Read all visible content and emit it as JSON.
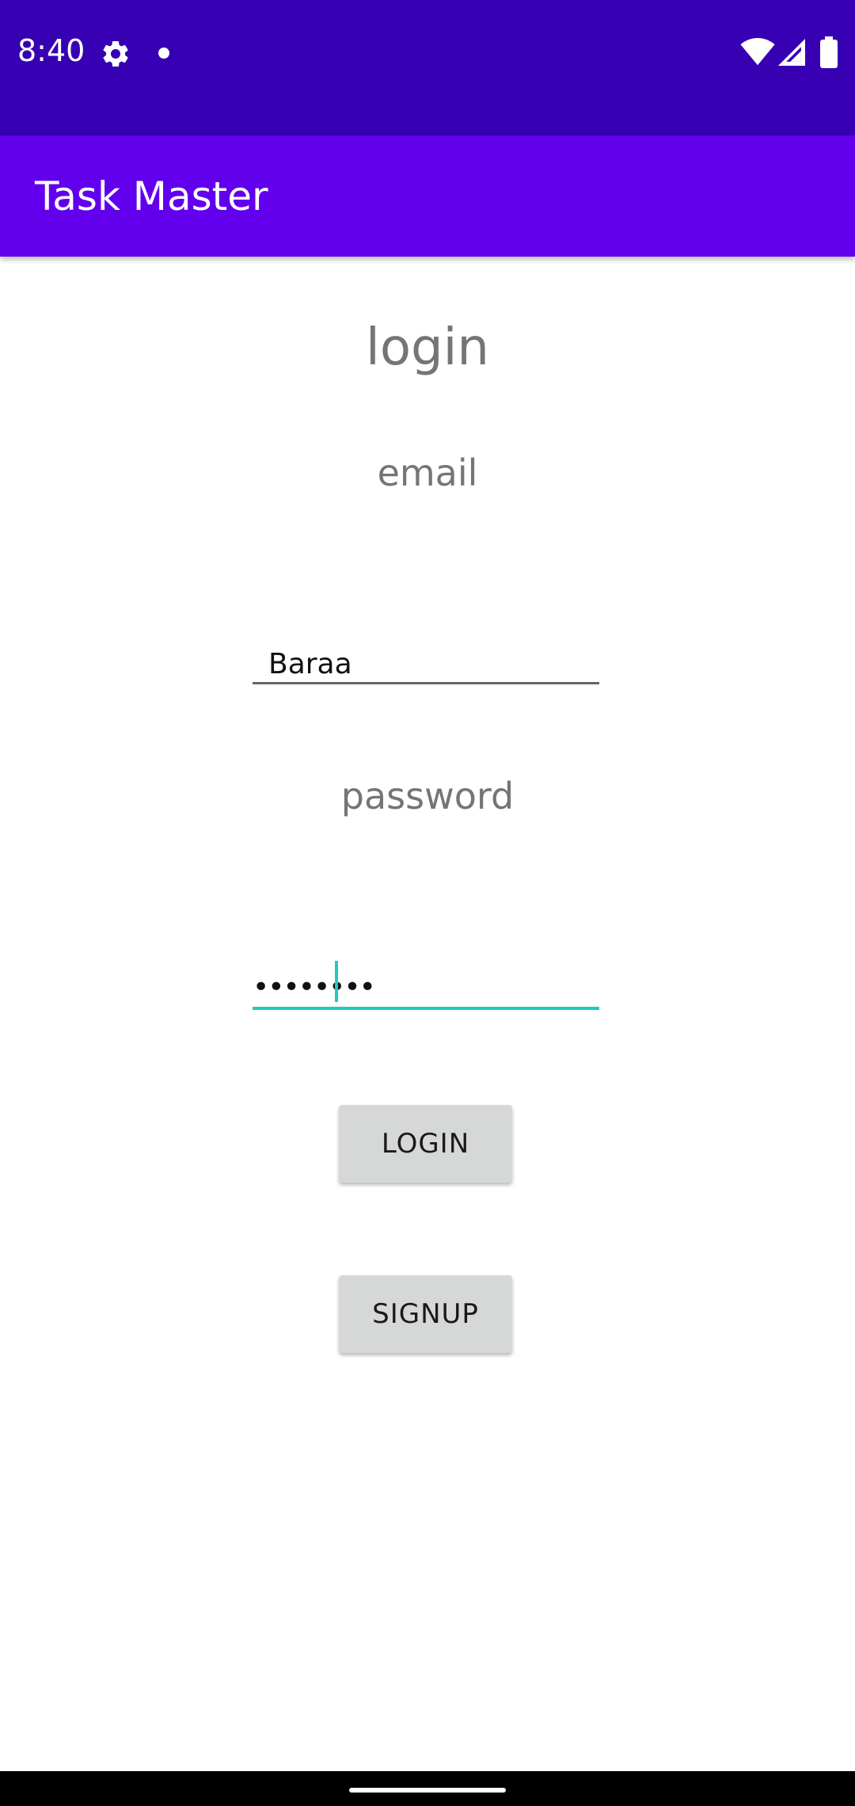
{
  "status_bar": {
    "time": "8:40",
    "icons": [
      "gear-icon",
      "notification-dot-icon",
      "wifi-icon",
      "signal-icon",
      "battery-icon"
    ],
    "background": "#3700B3"
  },
  "app_bar": {
    "title": "Task Master",
    "background": "#6200EE"
  },
  "form": {
    "title": "login",
    "email_label": "email",
    "email_value": "Baraa",
    "password_label": "password",
    "password_value": "••••••••",
    "focus_color": "#1ECBC1"
  },
  "buttons": {
    "login_label": "LOGIN",
    "signup_label": "SIGNUP"
  }
}
